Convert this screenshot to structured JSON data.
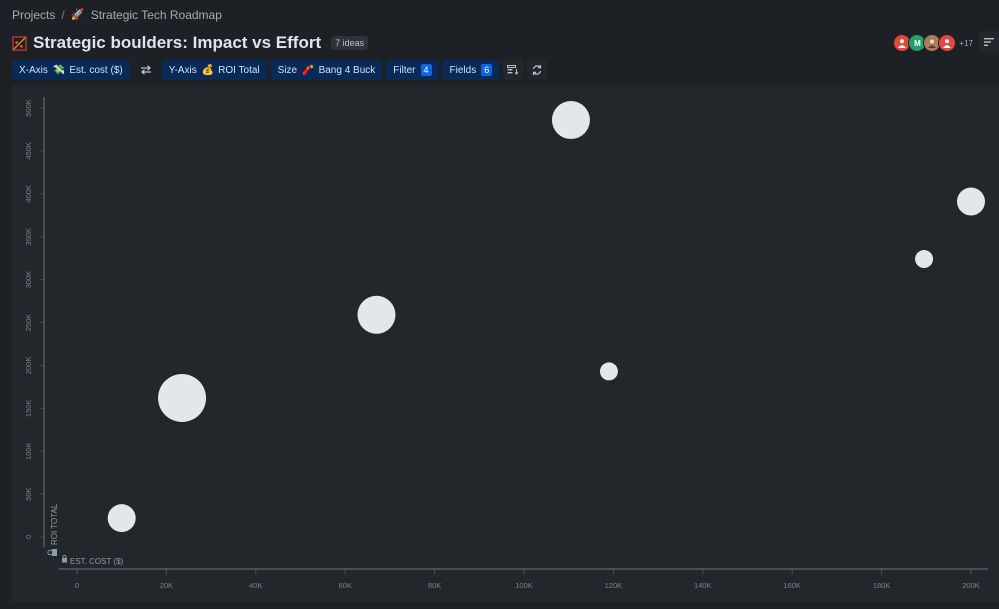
{
  "breadcrumb": {
    "projects": "Projects",
    "separator": "/",
    "project": "Strategic Tech Roadmap",
    "project_icon": "rocket-icon"
  },
  "header": {
    "title": "Strategic boulders: Impact vs Effort",
    "title_icon": "scatter-plot-icon",
    "count": "7 ideas"
  },
  "collaborators": {
    "avatars": [
      "user-avatar",
      "M",
      "photo-avatar",
      "user-avatar"
    ],
    "more": "+17"
  },
  "toolbar": {
    "x_axis": {
      "label": "X-Axis",
      "emoji": "💸",
      "value": "Est. cost ($)"
    },
    "swap_icon": "swap-axes-icon",
    "y_axis": {
      "label": "Y-Axis",
      "emoji": "💰",
      "value": "ROI Total"
    },
    "size": {
      "label": "Size",
      "emoji": "🧨",
      "value": "Bang 4 Buck"
    },
    "filter": {
      "label": "Filter",
      "count": "4"
    },
    "fields": {
      "label": "Fields",
      "count": "6"
    },
    "layout_icon": "card-layout-icon",
    "refresh_icon": "sync-icon"
  },
  "colors": {
    "background": "#1d2125",
    "panel": "#22272b",
    "toolbar_button": "#092957",
    "badge": "#0c66e4",
    "bubble": "#e3e6eb",
    "axis": "#454f59"
  },
  "chart_data": {
    "type": "scatter",
    "xlabel": "EST. COST ($)",
    "ylabel": "ROI TOTAL",
    "xlim": [
      0,
      200000
    ],
    "ylim": [
      0,
      500000
    ],
    "x_ticks": [
      0,
      20000,
      40000,
      60000,
      80000,
      100000,
      120000,
      140000,
      160000,
      180000,
      200000
    ],
    "x_tick_labels": [
      "0",
      "20K",
      "40K",
      "60K",
      "80K",
      "100K",
      "120K",
      "140K",
      "160K",
      "180K",
      "200K"
    ],
    "y_ticks": [
      0,
      50000,
      100000,
      150000,
      200000,
      250000,
      300000,
      350000,
      400000,
      450000,
      500000
    ],
    "y_tick_labels": [
      "0",
      "50K",
      "100K",
      "150K",
      "200K",
      "250K",
      "300K",
      "350K",
      "400K",
      "450K",
      "500K"
    ],
    "grid": false,
    "points": [
      {
        "x": 10000,
        "y": 22000,
        "size": 14
      },
      {
        "x": 23500,
        "y": 162000,
        "size": 24
      },
      {
        "x": 67000,
        "y": 259000,
        "size": 19
      },
      {
        "x": 110500,
        "y": 486000,
        "size": 19
      },
      {
        "x": 119000,
        "y": 193000,
        "size": 9
      },
      {
        "x": 189500,
        "y": 324000,
        "size": 9
      },
      {
        "x": 200000,
        "y": 391000,
        "size": 14
      }
    ]
  }
}
